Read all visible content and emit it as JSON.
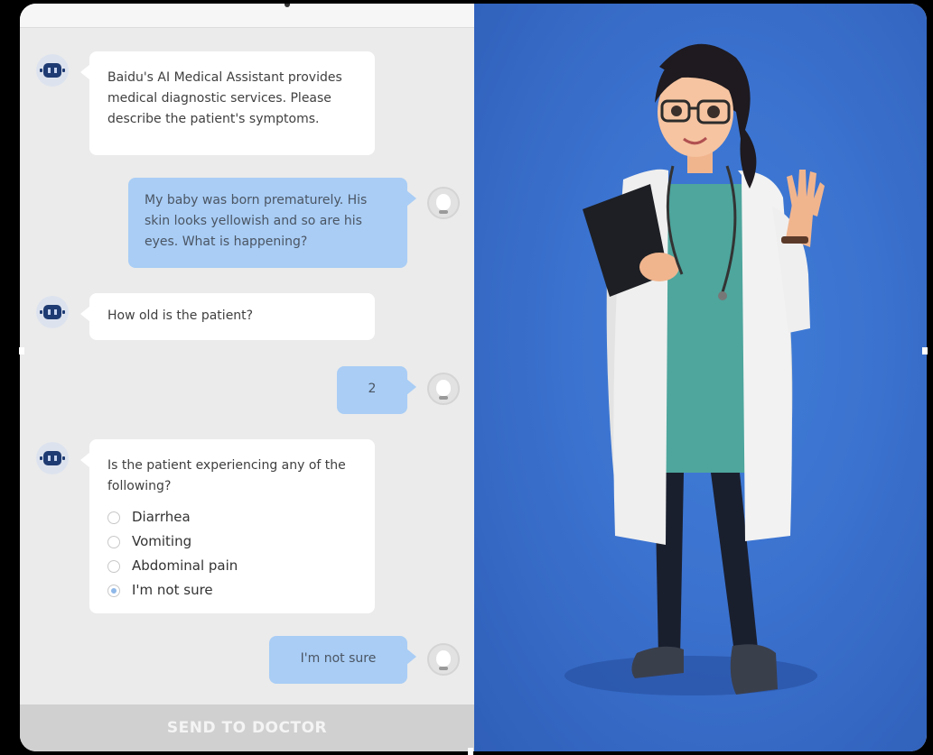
{
  "chat": {
    "messages": [
      {
        "from": "bot",
        "text": "Baidu's AI Medical Assistant provides medical diagnostic services. Please describe the patient's symptoms."
      },
      {
        "from": "user",
        "text": "My baby was born prematurely. His skin looks yellowish and so are his eyes. What is happening?"
      },
      {
        "from": "bot",
        "text": "How old is the patient?"
      },
      {
        "from": "user",
        "text": "2"
      },
      {
        "from": "bot",
        "text": "Is the patient experiencing any of the following?"
      },
      {
        "from": "user",
        "text": "I'm not sure"
      }
    ],
    "options": [
      {
        "label": "Diarrhea",
        "selected": false
      },
      {
        "label": "Vomiting",
        "selected": false
      },
      {
        "label": "Abdominal pain",
        "selected": false
      },
      {
        "label": "I'm not sure",
        "selected": true
      }
    ],
    "send_button": "SEND TO DOCTOR"
  },
  "icons": {
    "bot_avatar": "robot-icon",
    "user_avatar": "user-avatar-icon"
  },
  "colors": {
    "user_bubble": "#a9cdf5",
    "bot_bubble": "#ffffff",
    "chat_background": "#ebebeb",
    "send_bar": "#d0d0d0",
    "illustration_background": "#3b72cf",
    "robot": "#1f3b73"
  }
}
